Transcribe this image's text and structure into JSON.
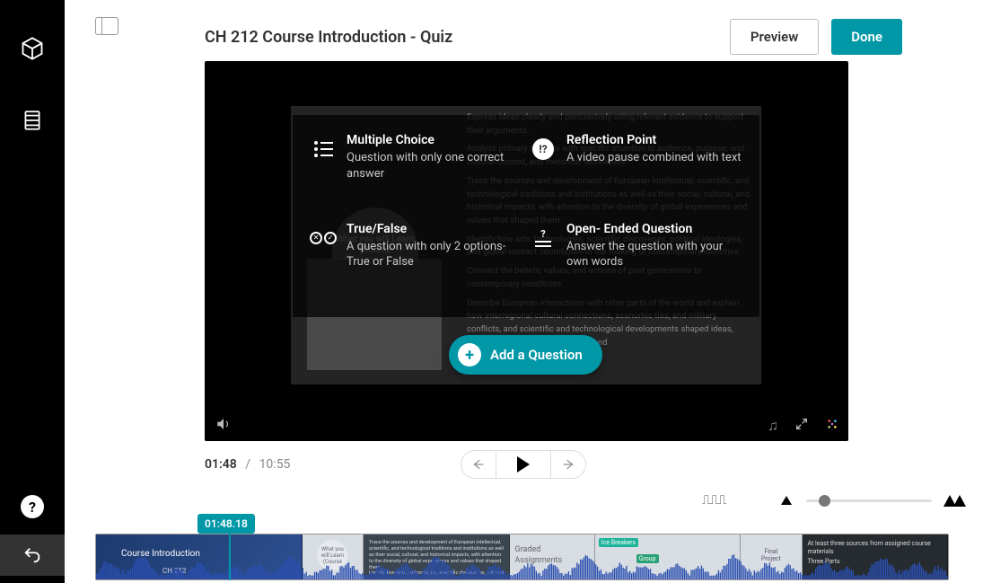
{
  "title": "CH 212 Course Introduction - Quiz",
  "buttons": {
    "preview": "Preview",
    "done": "Done",
    "add_question": "Add a Question"
  },
  "playback": {
    "current": "01:48",
    "duration": "10:55",
    "playhead_tag": "01:48.18"
  },
  "slide_circle_text": "What you\nwill Learn\n(Course",
  "question_types": {
    "mc": {
      "title": "Multiple Choice",
      "desc": "Question with only one correct answer"
    },
    "tf": {
      "title": "True/False",
      "desc": "A question with only 2 options- True or False"
    },
    "refl": {
      "title": "Reflection Point",
      "desc": "A video pause combined with text"
    },
    "open": {
      "title": "Open- Ended Question",
      "desc": "Answer the question with your own words"
    }
  },
  "slide_text": {
    "p1": "Express ideas clearly and persuasively using relevant evidence to support their arguments.",
    "p2": "Analyze primary sources with specific attention to audience, purpose, and cultural context, and rhetorical techniques.",
    "p3": "Trace the sources and development of European intellectual, scientific, and technological traditions and institutions as well as their social, cultural, and historical impacts, with attention to the diversity of global experiences and values that shaped them.",
    "p4": "Identify how arts, technologies, scientific discoveries, political ideologies, and global contact contributed to the making of contemporary identities.",
    "p5": "Connect the beliefs, values, and actions of past generations to contemporary conditions.",
    "p6": "Describe European interactions with other parts of the world and explain how interregional cultural connections, economic ties, and military conflicts, and scientific and technological developments shaped ideas, beliefs, and values in the modern and"
  },
  "timeline_thumbs": {
    "t0_title": "Course Introduction",
    "t0_sub": "CH 212",
    "t1_label": "What you will Learn (Course",
    "t2_text": "Trace the sources and development of European intellectual, scientific, and technological traditions and institutions as well as their social, cultural, and historical impacts, with attention to the diversity of global experiences and values that shaped them.\nIdentify how arts, technologies, scientific discoveries, political",
    "t3_line1": "Graded",
    "t3_line2": "Assignments",
    "t4_chip1": "Ice Breakers",
    "t4_chip2": "Group",
    "t5_label": "Final Project",
    "t6_l1": "At least three sources from assigned course materials",
    "t6_l2": "Three Parts"
  },
  "colors": {
    "accent": "#0097a7"
  }
}
